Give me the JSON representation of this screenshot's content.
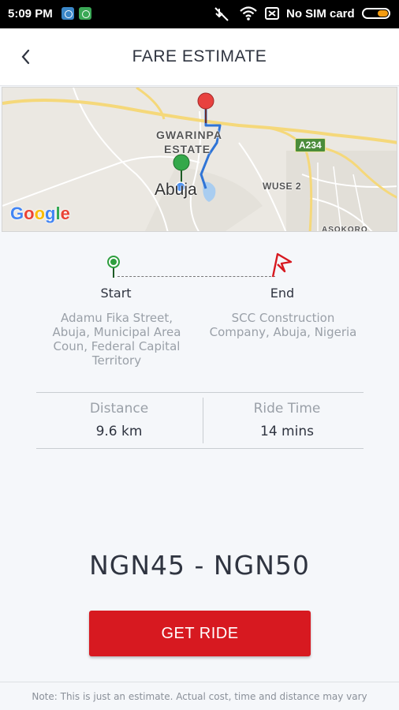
{
  "status_bar": {
    "time": "5:09 PM",
    "carrier": "No SIM card",
    "battery_level": 0.45,
    "icons": [
      "app-icon-1",
      "app-icon-2",
      "mute-icon",
      "wifi-icon",
      "sim-icon",
      "battery-icon"
    ]
  },
  "header": {
    "title": "FARE ESTIMATE",
    "back_icon": "chevron-left-icon"
  },
  "map": {
    "labels": [
      "GWARINPA",
      "ESTATE",
      "Abuja",
      "WUSE 2",
      "ASOKORO"
    ],
    "road_badge": "A234",
    "logo_text": [
      "G",
      "o",
      "o",
      "g",
      "l",
      "e"
    ]
  },
  "route": {
    "start_label": "Start",
    "end_label": "End",
    "start_address": "Adamu Fika Street, Abuja, Municipal Area Coun, Federal Capital Territory",
    "end_address": "SCC Construction Company, Abuja, Nigeria"
  },
  "stats": {
    "distance_label": "Distance",
    "distance_value": "9.6 km",
    "time_label": "Ride Time",
    "time_value": "14 mins"
  },
  "fare": {
    "range": "NGN45 - NGN50"
  },
  "actions": {
    "get_ride_label": "GET RIDE"
  },
  "note": "Note: This is just an estimate. Actual cost, time and distance may vary",
  "colors": {
    "accent": "#d71920",
    "start_pin": "#2e9e3e",
    "end_pin": "#e8423f",
    "route_line": "#2f74d6",
    "battery": "#f39c12"
  }
}
